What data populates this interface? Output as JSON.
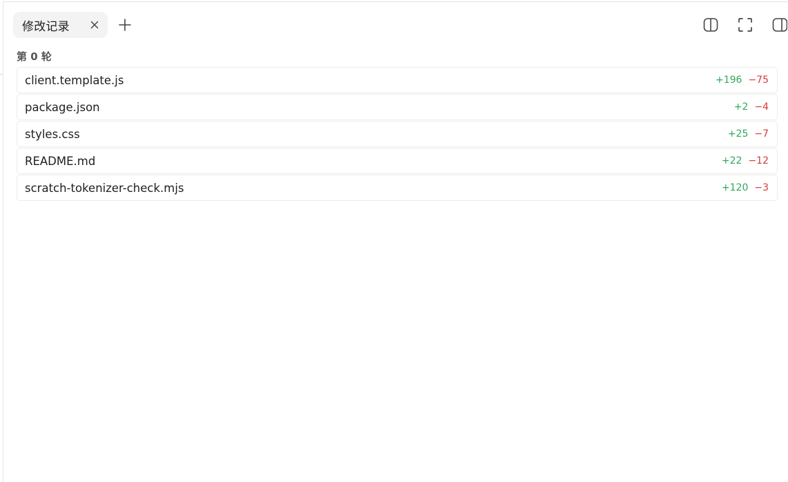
{
  "tabs": [
    {
      "label": "修改记录"
    }
  ],
  "icons": {
    "tab_close": "close-icon",
    "add_tab": "plus-icon",
    "split_view": "split-view-icon",
    "fullscreen": "fullscreen-icon",
    "toggle_sidebar": "sidebar-right-icon"
  },
  "round": {
    "title": "第 0 轮"
  },
  "files": [
    {
      "name": "client.template.js",
      "added": "+196",
      "removed": "−75"
    },
    {
      "name": "package.json",
      "added": "+2",
      "removed": "−4"
    },
    {
      "name": "styles.css",
      "added": "+25",
      "removed": "−7"
    },
    {
      "name": "README.md",
      "added": "+22",
      "removed": "−12"
    },
    {
      "name": "scratch-tokenizer-check.mjs",
      "added": "+120",
      "removed": "−3"
    }
  ],
  "colors": {
    "added": "#2fa85a",
    "removed": "#d83a3a",
    "tab_background": "#f3f3f3"
  }
}
